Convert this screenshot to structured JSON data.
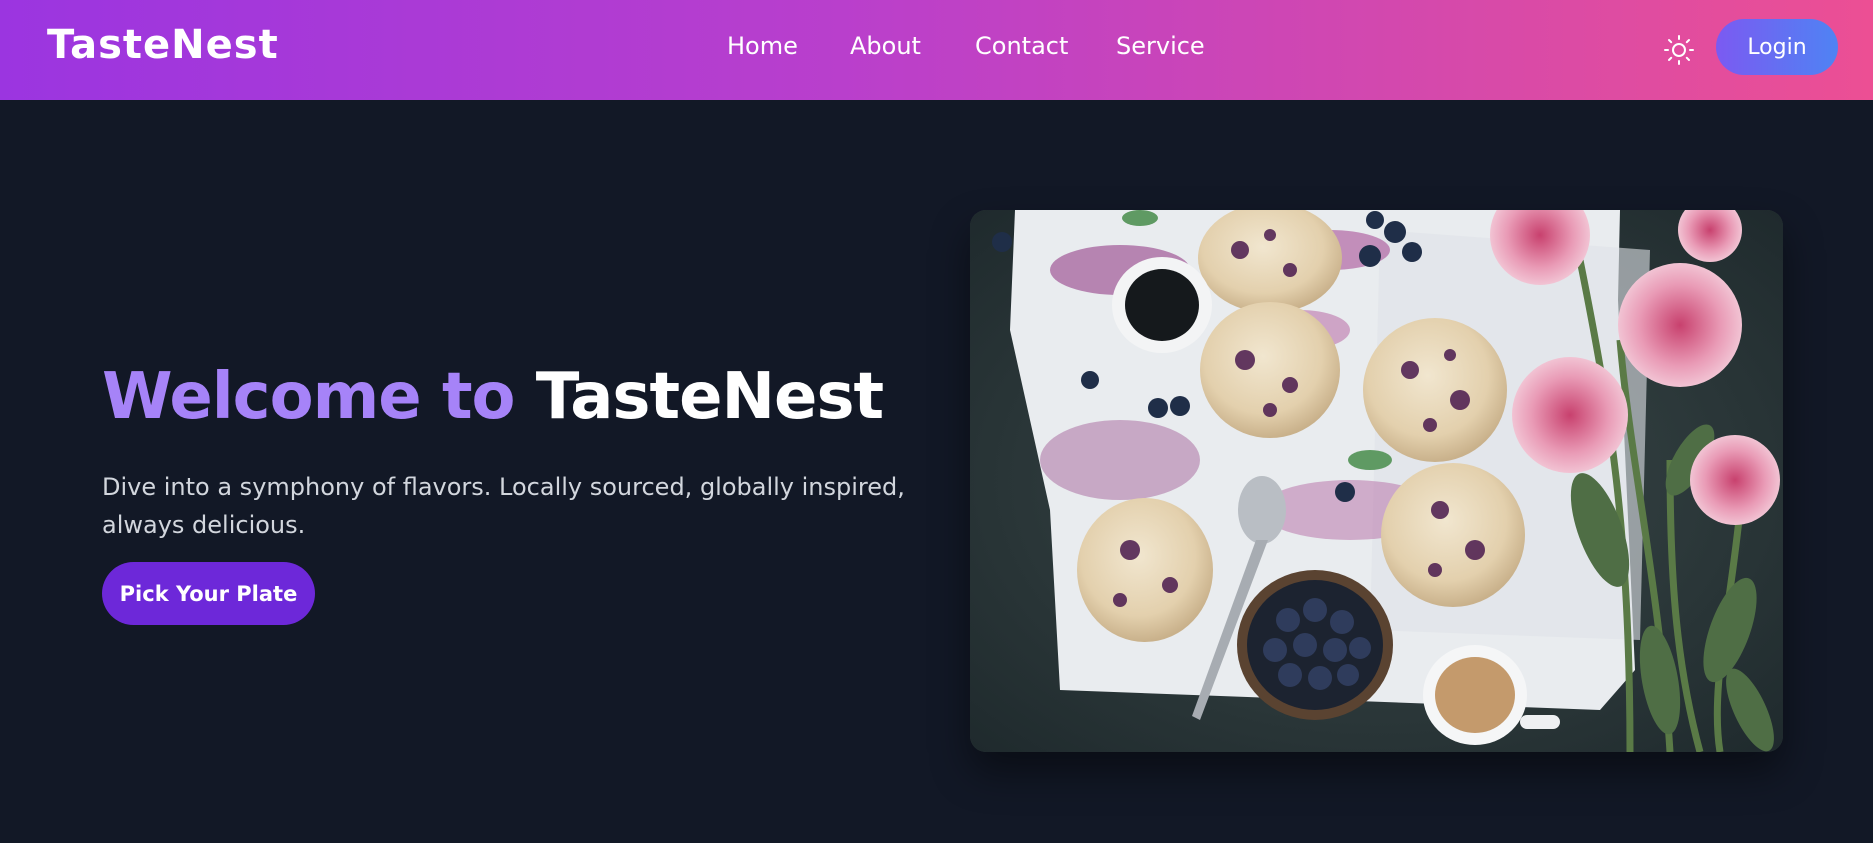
{
  "header": {
    "brand": "TasteNest",
    "nav": [
      "Home",
      "About",
      "Contact",
      "Service"
    ],
    "theme_icon": "sun-icon",
    "login_label": "Login"
  },
  "hero": {
    "title_accent": "Welcome to ",
    "title_brand": "TasteNest",
    "description": "Dive into a symphony of flavors. Locally sourced, globally inspired, always delicious.",
    "cta_label": "Pick Your Plate",
    "image_alt": "Blueberry scones with coffee, blueberries and pink peonies"
  },
  "colors": {
    "header_gradient": [
      "#9b35e0",
      "#ec4f94"
    ],
    "page_background": "#121826",
    "accent_text": "#a683f8",
    "cta_button": "#6d28d9",
    "login_gradient": [
      "#7b5af2",
      "#4f83f3"
    ]
  }
}
